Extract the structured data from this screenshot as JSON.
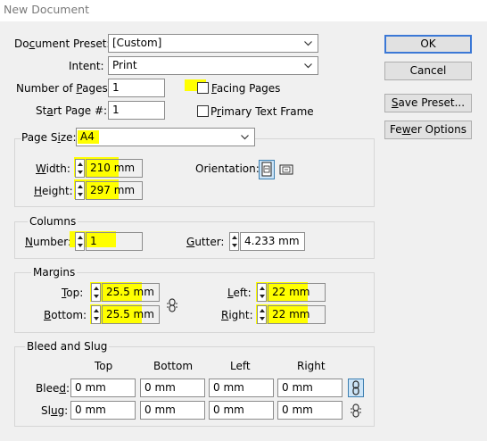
{
  "window": {
    "title": "New Document"
  },
  "document_preset": {
    "label_pre": "Do",
    "label_key": "c",
    "label_post": "ument Preset:",
    "value": "[Custom]"
  },
  "intent": {
    "label": "Intent:",
    "value": "Print"
  },
  "number_of_pages": {
    "label_pre": "Number of ",
    "label_key": "P",
    "label_post": "ages:",
    "value": "1"
  },
  "start_page": {
    "label_pre": "St",
    "label_key": "a",
    "label_post": "rt Page #:",
    "value": "1"
  },
  "facing_pages": {
    "label_key": "F",
    "label_post": "acing Pages",
    "checked": false
  },
  "primary_text_frame": {
    "label_pre": "P",
    "label_key": "r",
    "label_post": "imary Text Frame",
    "checked": false
  },
  "buttons": {
    "ok": "OK",
    "cancel": "Cancel",
    "save_preset_key": "S",
    "save_preset_post": "ave Preset...",
    "fewer_options_pre": "Fe",
    "fewer_options_key": "w",
    "fewer_options_post": "er Options"
  },
  "page_size": {
    "label_pre": "Page S",
    "label_key": "i",
    "label_post": "ze:",
    "value": "A4",
    "width_key": "W",
    "width_post": "idth:",
    "width_value": "210 mm",
    "height_key": "H",
    "height_post": "eight:",
    "height_value": "297 mm",
    "orientation_label": "Orientation:",
    "orientation_selected": "portrait"
  },
  "columns": {
    "legend": "Columns",
    "number_key": "N",
    "number_post": "umber:",
    "number_value": "1",
    "gutter_key": "G",
    "gutter_post": "utter:",
    "gutter_value": "4.233 mm"
  },
  "margins": {
    "legend": "Margins",
    "top_key": "T",
    "top_post": "op:",
    "top_value": "25.5 mm",
    "bottom_key": "B",
    "bottom_post": "ottom:",
    "bottom_value": "25.5 mm",
    "left_key": "L",
    "left_post": "eft:",
    "left_value": "22 mm",
    "right_key": "R",
    "right_post": "ight:",
    "right_value": "22 mm"
  },
  "bleed_slug": {
    "legend": "Bleed and Slug",
    "columns": [
      "Top",
      "Bottom",
      "Left",
      "Right"
    ],
    "bleed_pre": "Blee",
    "bleed_key": "d",
    "bleed_post": ":",
    "slug_pre": "Sl",
    "slug_key": "u",
    "slug_post": "g:",
    "bleed_values": [
      "0 mm",
      "0 mm",
      "0 mm",
      "0 mm"
    ],
    "slug_values": [
      "0 mm",
      "0 mm",
      "0 mm",
      "0 mm"
    ]
  },
  "colors": {
    "highlight": "#ffff00",
    "ok_border": "#3b78d6",
    "selected_icon_bg": "#cce4f7"
  }
}
